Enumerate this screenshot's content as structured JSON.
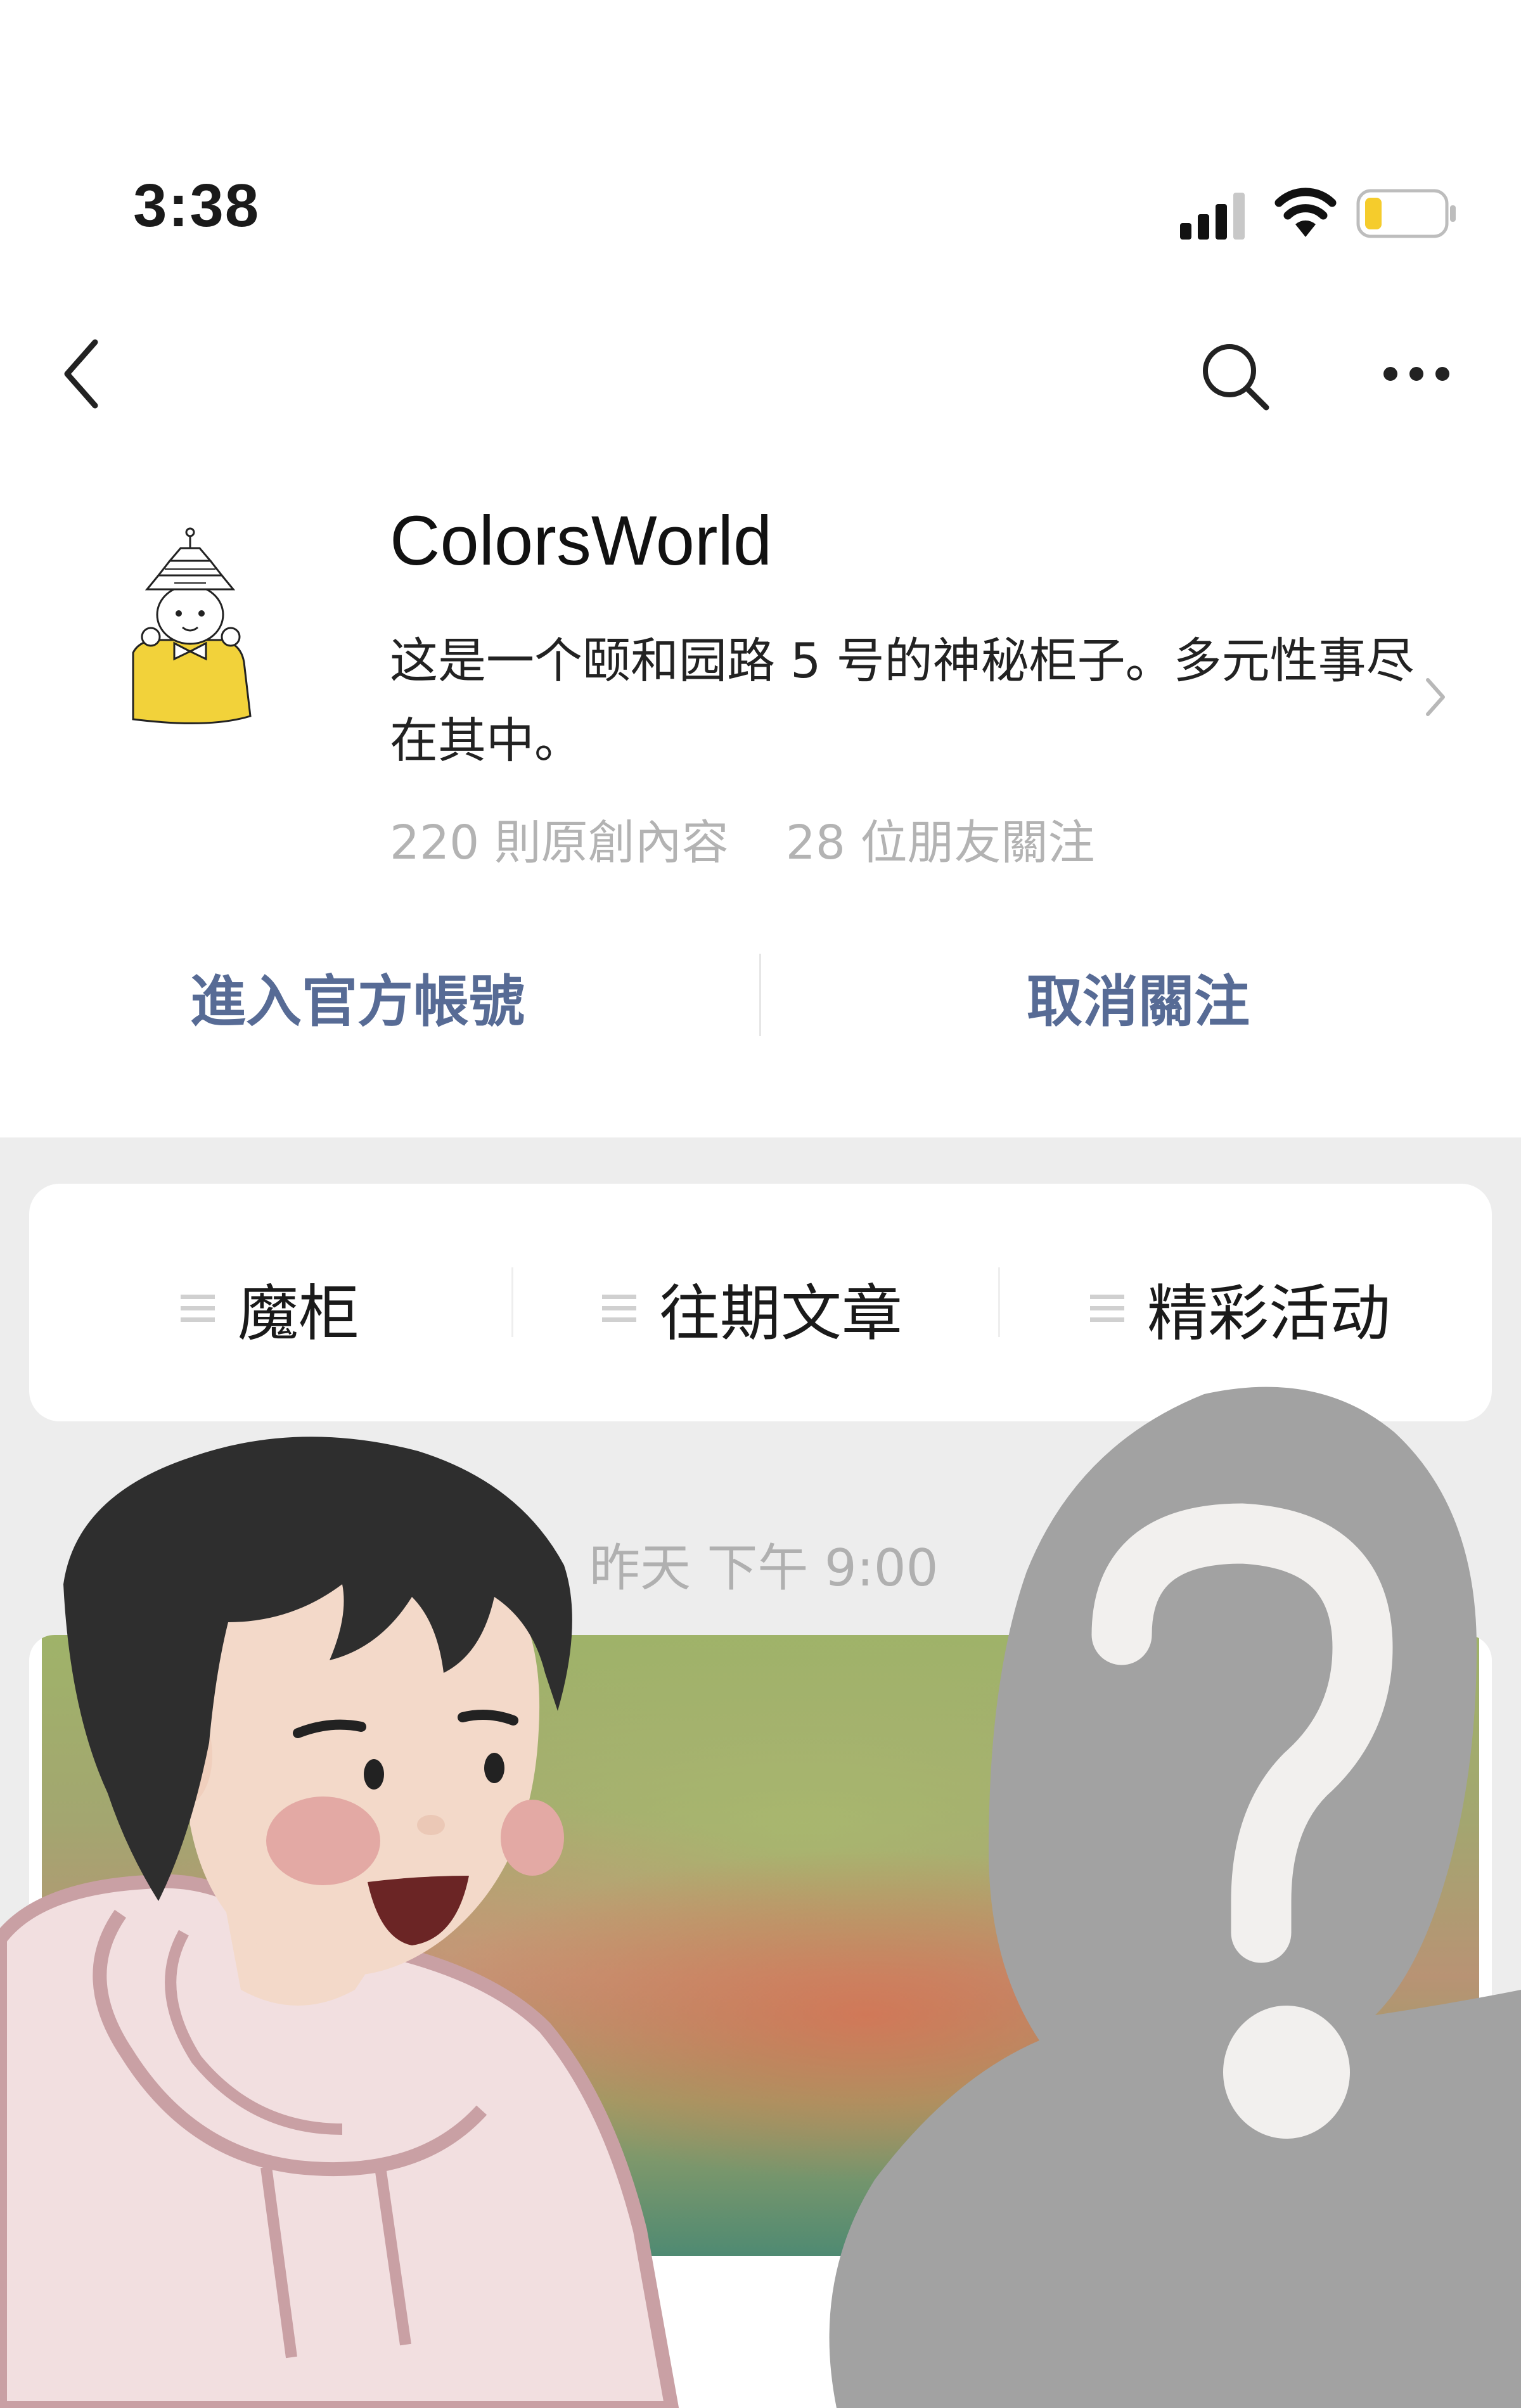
{
  "status_bar": {
    "time": "3:38"
  },
  "nav": {
    "back_icon": "chevron-left-icon",
    "search_icon": "search-icon",
    "more_icon": "more-dots-icon"
  },
  "profile": {
    "name": "ColorsWorld",
    "description": "这是一个颐和园路 5 号的神秘柜子。多元性事尽在其中。",
    "original_content": "220 則原創內容",
    "friends_following": "28 位朋友關注"
  },
  "actions": {
    "enter_official": "進入官方帳號",
    "unfollow": "取消關注"
  },
  "menu": {
    "items": [
      {
        "label": "魔柜"
      },
      {
        "label": "往期文章"
      },
      {
        "label": "精彩活动"
      }
    ]
  },
  "post": {
    "time": "昨天 下午 9:00"
  },
  "colors": {
    "link_blue": "#576b95",
    "gray_bg": "#ededed",
    "stat_gray": "#b3b3b3"
  }
}
